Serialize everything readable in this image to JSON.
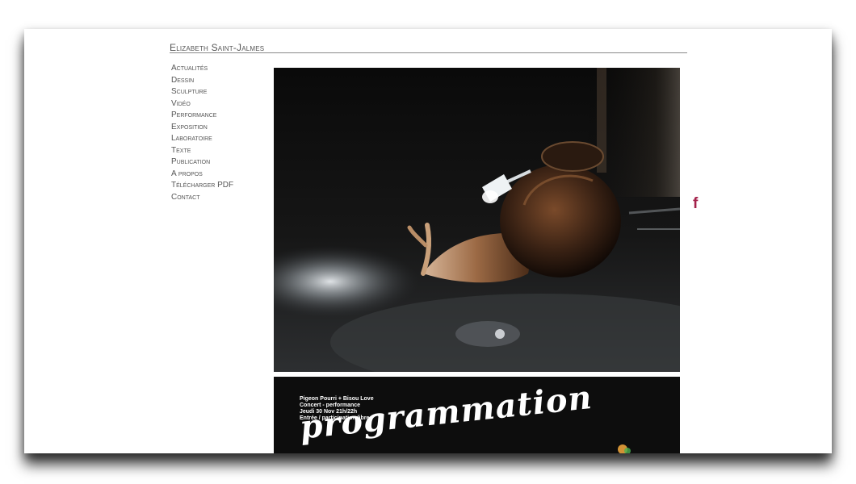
{
  "site": {
    "title": "Elizabeth Saint-Jalmes"
  },
  "nav": {
    "items": [
      {
        "label": "Actualités"
      },
      {
        "label": "Dessin"
      },
      {
        "label": "Sculpture"
      },
      {
        "label": "Vidéo"
      },
      {
        "label": "Performance"
      },
      {
        "label": "Exposition"
      },
      {
        "label": "Laboratoire"
      },
      {
        "label": "Texte"
      },
      {
        "label": "Publication"
      },
      {
        "label": "A propos"
      },
      {
        "label": "Télécharger PDF"
      },
      {
        "label": "Contact"
      }
    ]
  },
  "social": {
    "facebook_glyph": "f",
    "facebook_color": "#a3214a",
    "icon": "facebook-icon"
  },
  "poster": {
    "line1": "Pigeon Pourri + Bisou Love",
    "line2": "Concert - performance",
    "line3": "Jeudi 30 Nov 21h/22h",
    "line4": "Entrée / participation libre",
    "script_text": "programmation"
  },
  "colors": {
    "text": "#555555",
    "accent": "#a3214a",
    "background": "#ffffff"
  }
}
